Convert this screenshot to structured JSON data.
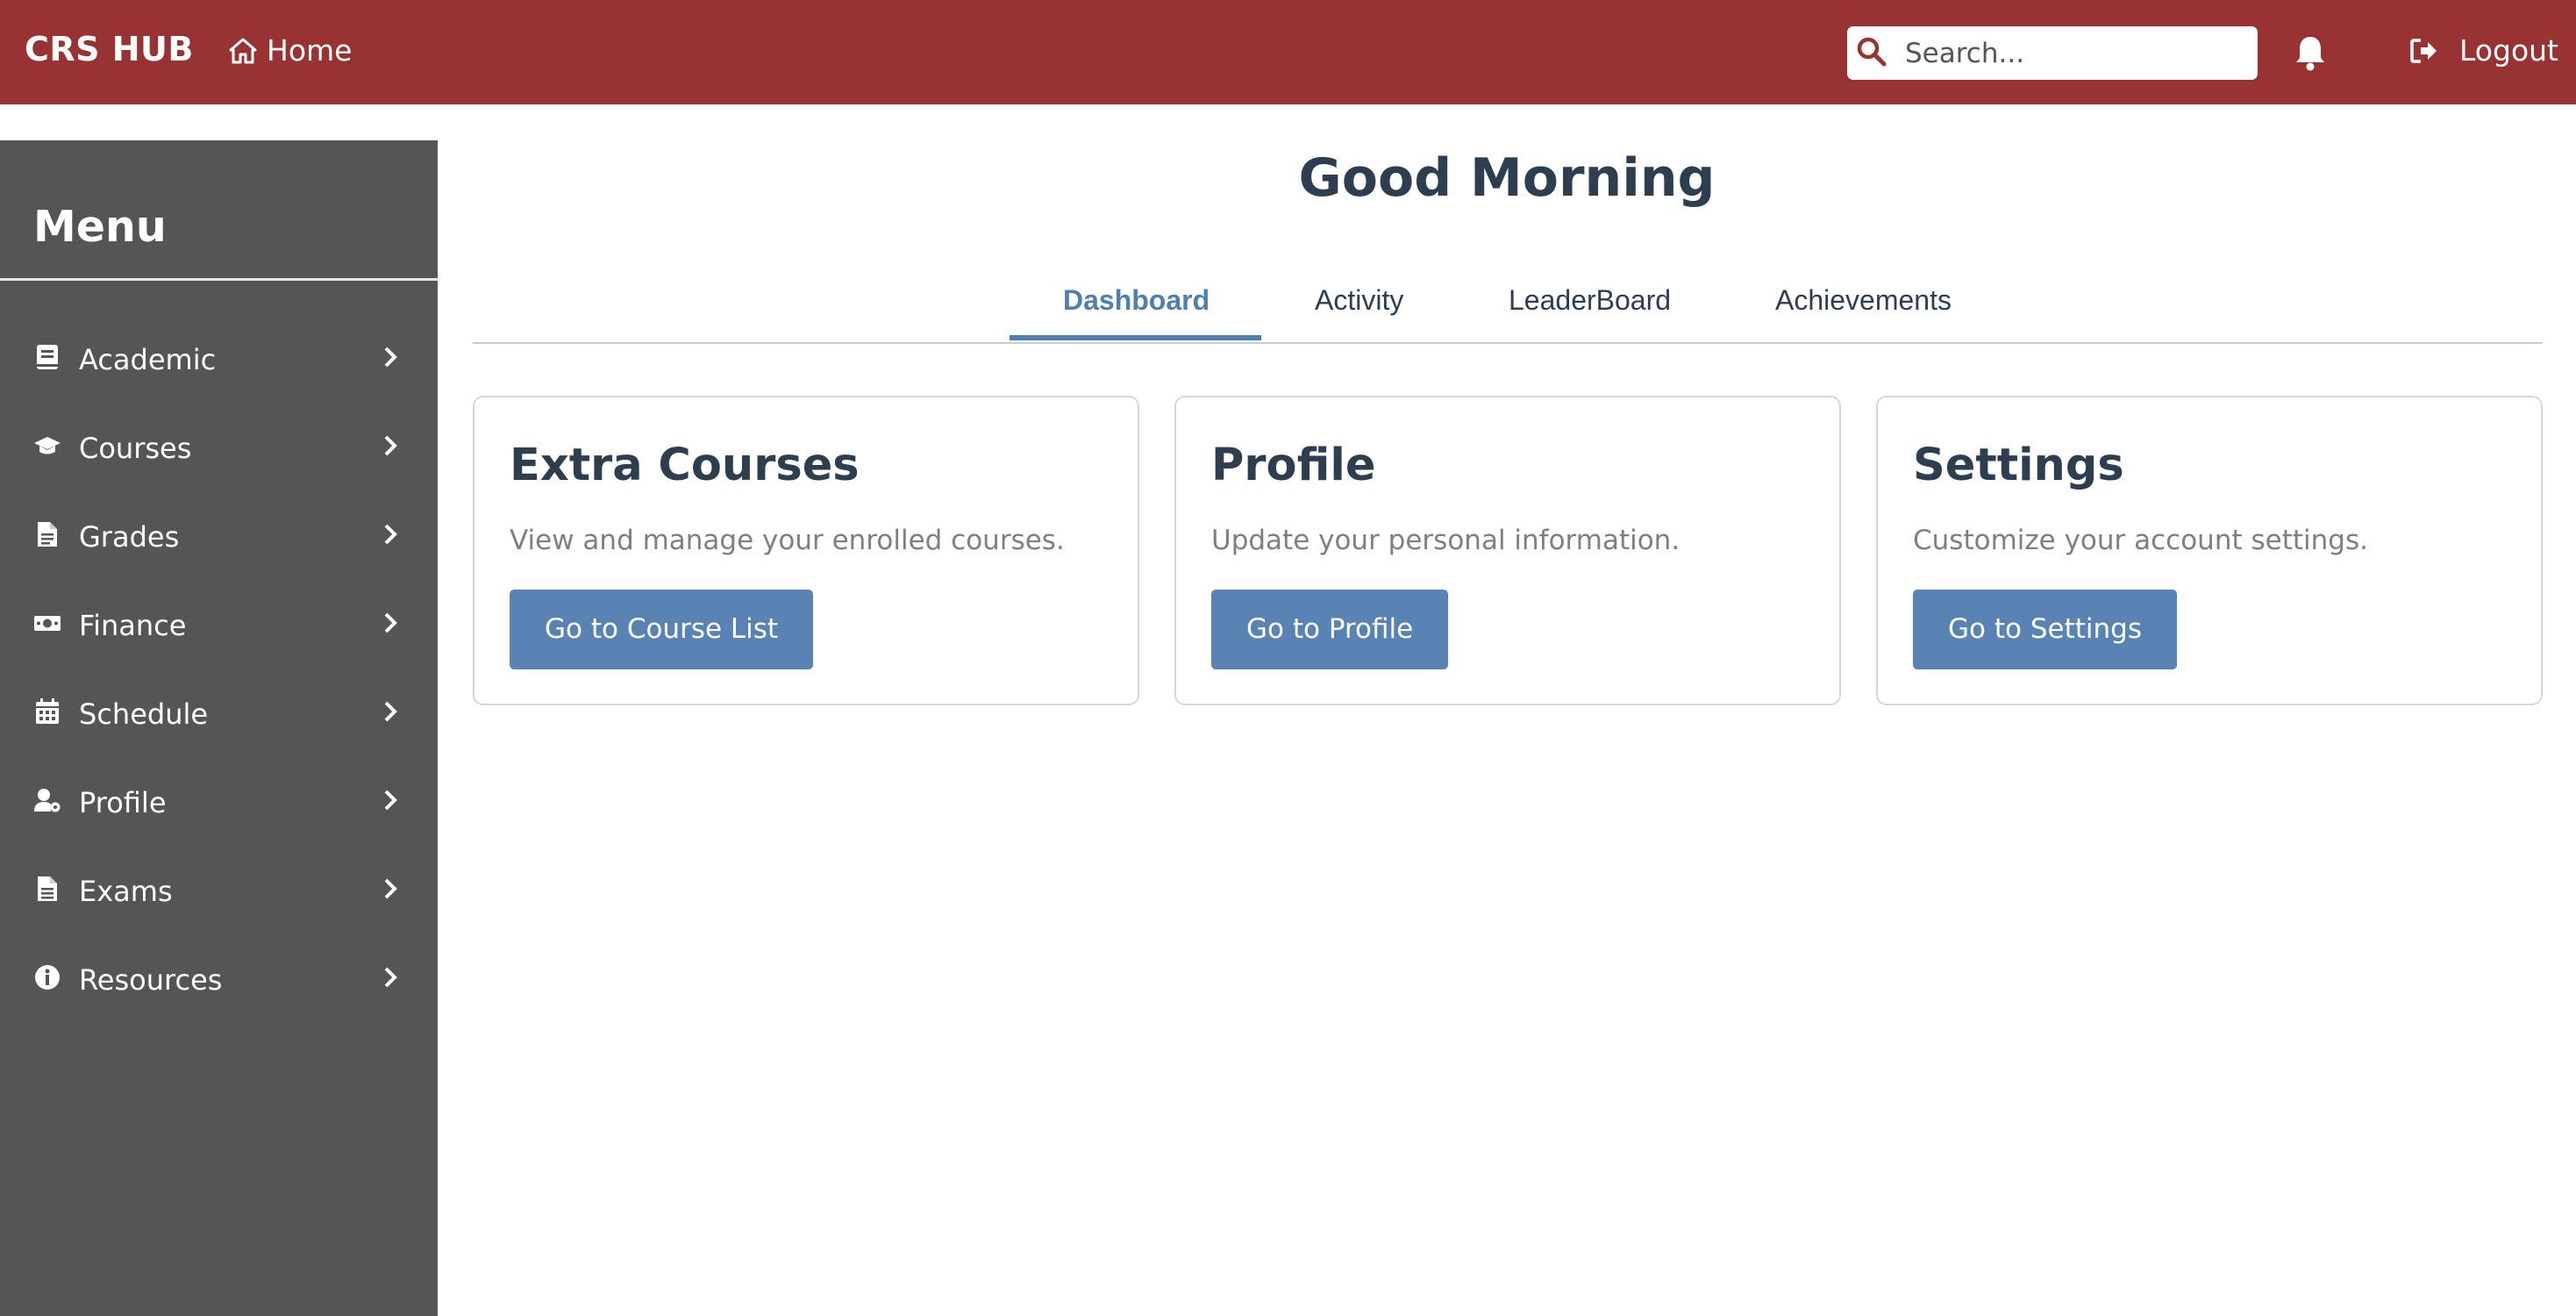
{
  "topbar": {
    "brand": "CRS HUB",
    "home_label": "Home",
    "search_placeholder": "Search...",
    "logout_label": "Logout",
    "background_color": "#993333"
  },
  "sidebar": {
    "title": "Menu",
    "background_color": "#555555",
    "items": [
      {
        "label": "Academic",
        "icon": "book-icon"
      },
      {
        "label": "Courses",
        "icon": "graduation-cap-icon"
      },
      {
        "label": "Grades",
        "icon": "document-icon"
      },
      {
        "label": "Finance",
        "icon": "money-icon"
      },
      {
        "label": "Schedule",
        "icon": "calendar-icon"
      },
      {
        "label": "Profile",
        "icon": "user-settings-icon"
      },
      {
        "label": "Exams",
        "icon": "file-icon"
      },
      {
        "label": "Resources",
        "icon": "info-icon"
      }
    ]
  },
  "main": {
    "greeting": "Good Morning",
    "tabs": [
      {
        "label": "Dashboard",
        "active": true
      },
      {
        "label": "Activity",
        "active": false
      },
      {
        "label": "LeaderBoard",
        "active": false
      },
      {
        "label": "Achievements",
        "active": false
      }
    ],
    "accent_color": "#4f7fb0",
    "cards": [
      {
        "title": "Extra Courses",
        "description": "View and manage your enrolled courses.",
        "button": "Go to Course List"
      },
      {
        "title": "Profile",
        "description": "Update your personal information.",
        "button": "Go to Profile"
      },
      {
        "title": "Settings",
        "description": "Customize your account settings.",
        "button": "Go to Settings"
      }
    ]
  }
}
